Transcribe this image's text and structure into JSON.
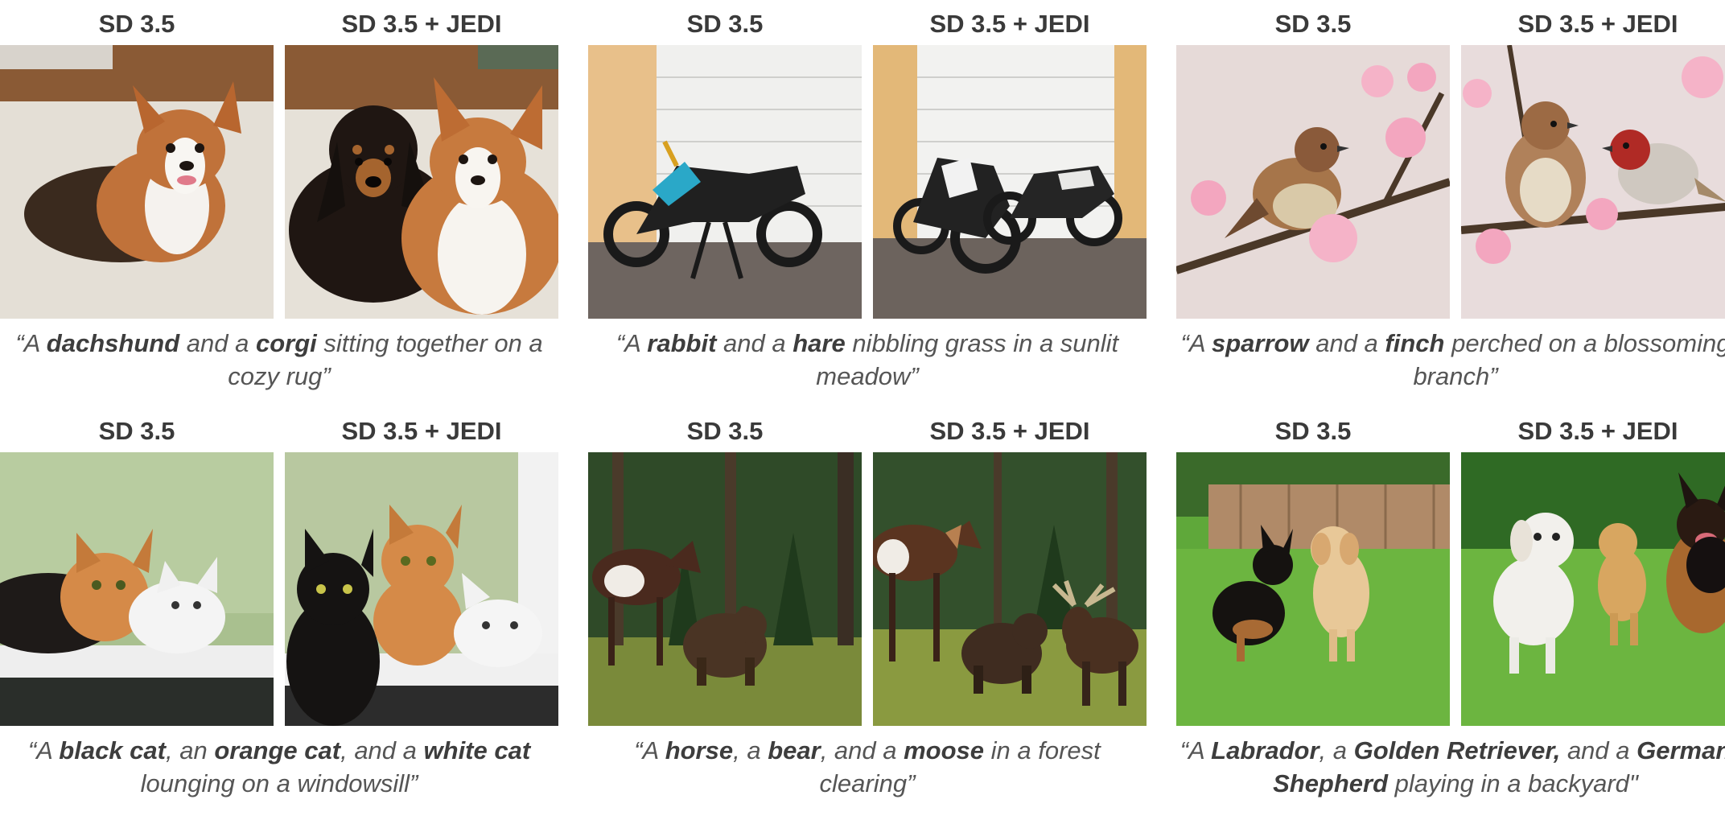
{
  "panels": [
    {
      "label_left": "SD 3.5",
      "label_right": "SD 3.5 + JEDI",
      "caption": [
        {
          "t": "“A ",
          "b": false
        },
        {
          "t": "dachshund",
          "b": true
        },
        {
          "t": " and a ",
          "b": false
        },
        {
          "t": "corgi",
          "b": true
        },
        {
          "t": " sitting together on a cozy rug”",
          "b": false
        }
      ]
    },
    {
      "label_left": "SD 3.5",
      "label_right": "SD 3.5 + JEDI",
      "caption": [
        {
          "t": "“A ",
          "b": false
        },
        {
          "t": "rabbit",
          "b": true
        },
        {
          "t": " and a ",
          "b": false
        },
        {
          "t": "hare",
          "b": true
        },
        {
          "t": " nibbling grass in a sunlit meadow”",
          "b": false
        }
      ]
    },
    {
      "label_left": "SD 3.5",
      "label_right": "SD 3.5 + JEDI",
      "caption": [
        {
          "t": "“A ",
          "b": false
        },
        {
          "t": "sparrow",
          "b": true
        },
        {
          "t": " and a ",
          "b": false
        },
        {
          "t": "finch",
          "b": true
        },
        {
          "t": " perched on a blossoming branch”",
          "b": false
        }
      ]
    },
    {
      "label_left": "SD 3.5",
      "label_right": "SD 3.5 + JEDI",
      "caption": [
        {
          "t": "“A ",
          "b": false
        },
        {
          "t": "black cat",
          "b": true
        },
        {
          "t": ", an ",
          "b": false
        },
        {
          "t": "orange cat",
          "b": true
        },
        {
          "t": ", and a ",
          "b": false
        },
        {
          "t": "white cat",
          "b": true
        },
        {
          "t": " lounging on a windowsill”",
          "b": false
        }
      ]
    },
    {
      "label_left": "SD 3.5",
      "label_right": "SD 3.5 + JEDI",
      "caption": [
        {
          "t": "“A ",
          "b": false
        },
        {
          "t": "horse",
          "b": true
        },
        {
          "t": ", a ",
          "b": false
        },
        {
          "t": "bear",
          "b": true
        },
        {
          "t": ", and a ",
          "b": false
        },
        {
          "t": "moose",
          "b": true
        },
        {
          "t": " in a forest clearing”",
          "b": false
        }
      ]
    },
    {
      "label_left": "SD 3.5",
      "label_right": "SD 3.5 + JEDI",
      "caption": [
        {
          "t": "“A ",
          "b": false
        },
        {
          "t": "Labrador",
          "b": true
        },
        {
          "t": ", a ",
          "b": false
        },
        {
          "t": "Golden Retriever,",
          "b": true
        },
        {
          "t": " and a ",
          "b": false
        },
        {
          "t": "German Shepherd",
          "b": true
        },
        {
          "t": " playing in a backyard\"",
          "b": false
        }
      ]
    }
  ]
}
